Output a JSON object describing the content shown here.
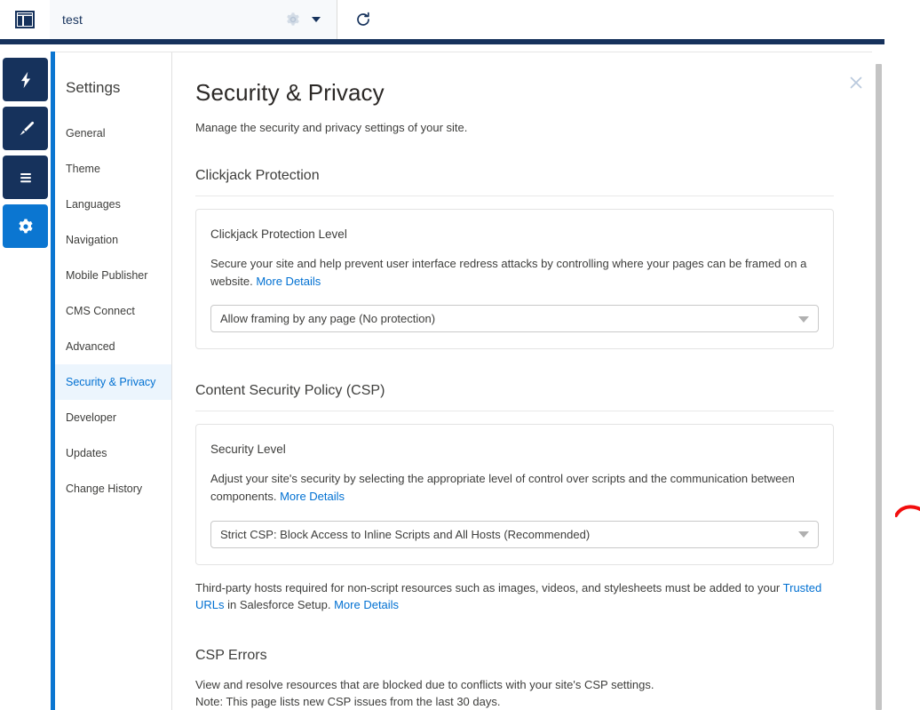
{
  "topbar": {
    "logo_icon": "layout-panel-icon",
    "tab_label": "test",
    "gear_icon": "gear-icon",
    "caret_icon": "chevron-down-icon",
    "refresh_icon": "refresh-icon"
  },
  "icon_rail": {
    "items": [
      {
        "icon": "lightning-bolt-icon",
        "selected": false
      },
      {
        "icon": "paintbrush-icon",
        "selected": false
      },
      {
        "icon": "lines-menu-icon",
        "selected": false
      },
      {
        "icon": "gear-icon",
        "selected": true
      }
    ]
  },
  "sidebar": {
    "title": "Settings",
    "items": [
      {
        "label": "General",
        "active": false
      },
      {
        "label": "Theme",
        "active": false
      },
      {
        "label": "Languages",
        "active": false
      },
      {
        "label": "Navigation",
        "active": false
      },
      {
        "label": "Mobile Publisher",
        "active": false
      },
      {
        "label": "CMS Connect",
        "active": false
      },
      {
        "label": "Advanced",
        "active": false
      },
      {
        "label": "Security & Privacy",
        "active": true
      },
      {
        "label": "Developer",
        "active": false
      },
      {
        "label": "Updates",
        "active": false
      },
      {
        "label": "Change History",
        "active": false
      }
    ]
  },
  "content": {
    "close_icon": "close-icon",
    "title": "Security & Privacy",
    "subtitle": "Manage the security and privacy settings of your site.",
    "clickjack": {
      "section_heading": "Clickjack Protection",
      "card_title": "Clickjack Protection Level",
      "card_desc": "Secure your site and help prevent user interface redress attacks by controlling where your pages can be framed on a website.",
      "card_desc_link": "More Details",
      "select_value": "Allow framing by any page (No protection)"
    },
    "csp": {
      "section_heading": "Content Security Policy (CSP)",
      "card_title": "Security Level",
      "card_desc": "Adjust your site's security by selecting the appropriate level of control over scripts and the communication between components.",
      "card_desc_link": "More Details",
      "select_value": "Strict CSP: Block Access to Inline Scripts and All Hosts (Recommended)",
      "footnote_pre": "Third-party hosts required for non-script resources such as images, videos, and stylesheets must be added to your ",
      "footnote_link_1": "Trusted URLs",
      "footnote_mid": " in Salesforce Setup. ",
      "footnote_link_2": "More Details"
    },
    "csp_errors": {
      "section_heading": "CSP Errors",
      "line_1": "View and resolve resources that are blocked due to conflicts with your site's CSP settings.",
      "line_2": "Note: This page lists new CSP issues from the last 30 days."
    }
  },
  "scrollbar": {
    "name": "vertical-scrollbar"
  },
  "annotation": {
    "name": "red-ink-annotation",
    "color": "#f20d0d"
  },
  "colors": {
    "navy": "#16325c",
    "accent_blue": "#0b76d1",
    "link_blue": "#0070d2",
    "active_nav_bg": "#ecf5fd",
    "text": "#3e3e3c",
    "border": "#e3e3e3"
  }
}
